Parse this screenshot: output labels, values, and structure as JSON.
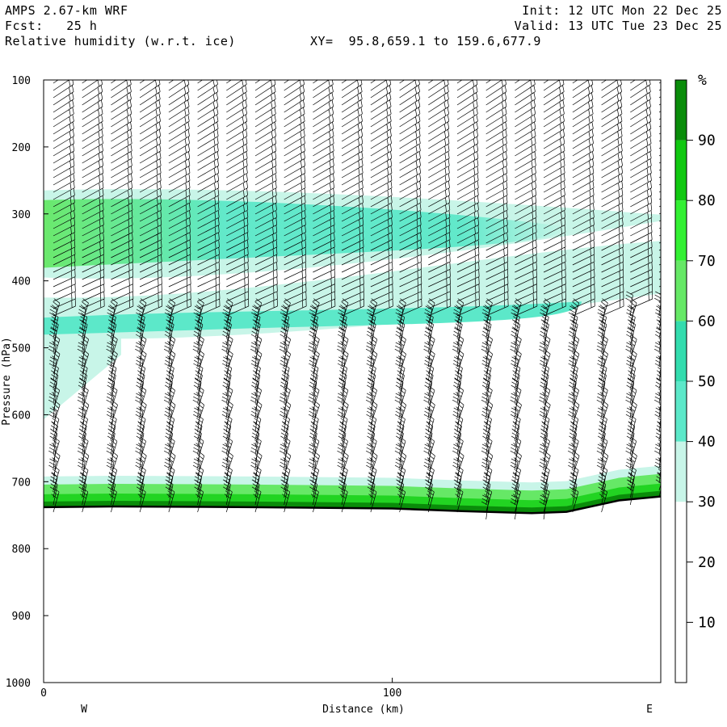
{
  "header": {
    "model": "AMPS 2.67-km WRF",
    "fcst": "Fcst:   25 h",
    "field": "Relative humidity (w.r.t. ice)",
    "xy": "XY=  95.8,659.1 to 159.6,677.9",
    "init": "Init: 12 UTC Mon 22 Dec 25",
    "valid": "Valid: 13 UTC Tue 23 Dec 25"
  },
  "chart_data": {
    "type": "heatmap",
    "title": "Relative humidity (w.r.t. ice)",
    "xlabel": "Distance (km)",
    "ylabel": "Pressure (hPa)",
    "xlim": [
      0,
      177
    ],
    "ylim": [
      1000,
      100
    ],
    "x_ticks": [
      0,
      100
    ],
    "y_ticks": [
      100,
      200,
      300,
      400,
      500,
      600,
      700,
      800,
      900,
      1000
    ],
    "x_end_labels": [
      "W",
      "E"
    ],
    "colorbar": {
      "unit": "%",
      "levels": [
        10,
        20,
        30,
        40,
        50,
        60,
        70,
        80,
        90
      ],
      "colors": [
        "#ffffff",
        "#ffffff",
        "#ffffff",
        "#c8f5e8",
        "#5ce8c9",
        "#33dcae",
        "#66e866",
        "#33f033",
        "#11c811",
        "#0a8c0a"
      ]
    },
    "rh_layers": [
      {
        "name": "upper moist layer",
        "x_range": [
          0,
          177
        ],
        "p_top": 265,
        "p_bottom": 395,
        "max_rh": 65
      },
      {
        "name": "mid moist layer",
        "x_range": [
          0,
          177
        ],
        "p_top": 455,
        "p_bottom": 595,
        "max_rh": 48
      },
      {
        "name": "near-surface moist layer",
        "x_range": [
          0,
          177
        ],
        "p_top": 705,
        "p_bottom": 745,
        "max_rh": 85
      }
    ],
    "surface_pressure": [
      {
        "x": 0,
        "p": 738
      },
      {
        "x": 20,
        "p": 737
      },
      {
        "x": 60,
        "p": 738
      },
      {
        "x": 100,
        "p": 740
      },
      {
        "x": 120,
        "p": 744
      },
      {
        "x": 140,
        "p": 747
      },
      {
        "x": 150,
        "p": 745
      },
      {
        "x": 165,
        "p": 728
      },
      {
        "x": 177,
        "p": 722
      }
    ],
    "wind_barb_columns": 22,
    "grid": false
  }
}
